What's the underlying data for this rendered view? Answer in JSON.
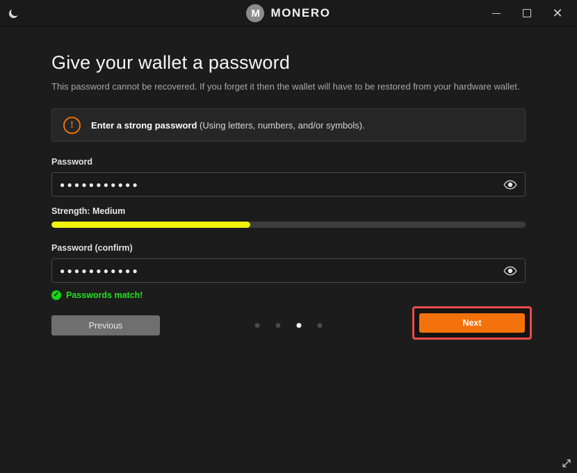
{
  "titlebar": {
    "theme_toggle_icon": "moon-icon",
    "brand_logo_letter": "M",
    "brand_name": "MONERO",
    "minimize_label": "–",
    "maximize_label": "□",
    "close_label": "✕"
  },
  "page": {
    "title": "Give your wallet a password",
    "subtitle": "This password cannot be recovered. If you forget it then the wallet will have to be restored from your hardware wallet."
  },
  "infobox": {
    "icon": "exclamation-circle-icon",
    "icon_glyph": "!",
    "strong_text": "Enter a strong password",
    "rest_text": " (Using letters, numbers, and/or symbols)."
  },
  "password": {
    "label": "Password",
    "value": "●●●●●●●●●●●",
    "placeholder": "",
    "reveal_icon": "eye-icon"
  },
  "strength": {
    "label": "Strength: Medium",
    "percent": 42,
    "color": "#f2f20d",
    "track_color": "#3c3c3c"
  },
  "confirm": {
    "label": "Password (confirm)",
    "value": "●●●●●●●●●●●",
    "placeholder": "",
    "reveal_icon": "eye-icon"
  },
  "match": {
    "icon": "check-circle-icon",
    "icon_glyph": "✓",
    "text": "Passwords match!",
    "color": "#21e021"
  },
  "nav": {
    "previous_label": "Previous",
    "next_label": "Next",
    "next_accent": "#f4720b",
    "highlight_color": "#f04a4a",
    "dots": [
      {
        "active": false
      },
      {
        "active": false
      },
      {
        "active": true
      },
      {
        "active": false
      }
    ]
  },
  "window": {
    "resize_grip_icon": "resize-handle-icon"
  }
}
